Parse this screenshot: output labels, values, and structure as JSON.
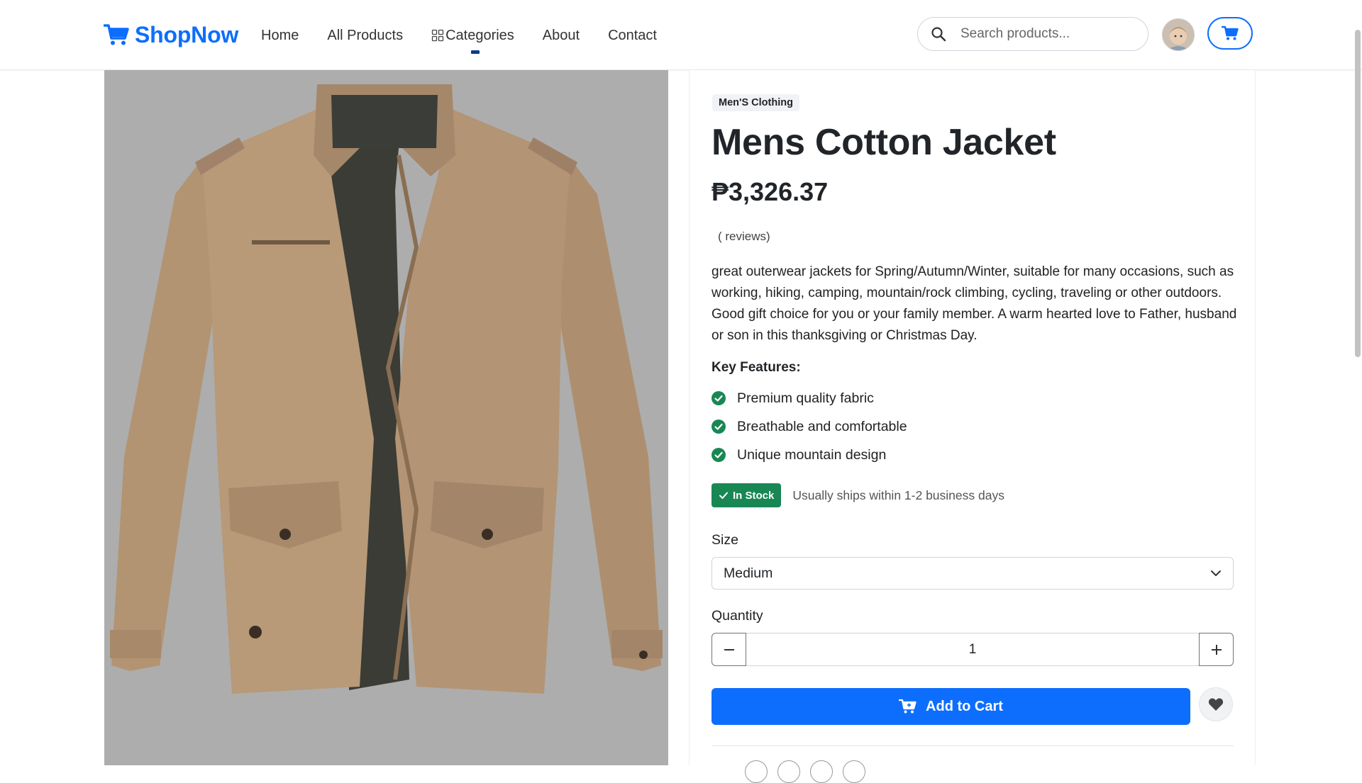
{
  "brand": {
    "name": "ShopNow",
    "icon": "cart-icon",
    "color": "#0d6efd"
  },
  "nav": {
    "links": [
      {
        "label": "Home"
      },
      {
        "label": "All Products"
      },
      {
        "label": "Categories",
        "icon": "grid-icon"
      },
      {
        "label": "About"
      },
      {
        "label": "Contact"
      }
    ]
  },
  "search": {
    "placeholder": "Search products...",
    "value": ""
  },
  "product": {
    "category": "Men'S Clothing",
    "title": "Mens Cotton Jacket",
    "price": "₱3,326.37",
    "reviews": "( reviews)",
    "description": "great outerwear jackets for Spring/Autumn/Winter, suitable for many occasions, such as working, hiking, camping, mountain/rock climbing, cycling, traveling or other outdoors. Good gift choice for you or your family member. A warm hearted love to Father, husband or son in this thanksgiving or Christmas Day.",
    "features_title": "Key Features:",
    "features": [
      "Premium quality fabric",
      "Breathable and comfortable",
      "Unique mountain design"
    ],
    "stock_badge": "In Stock",
    "shipping_note": "Usually ships within 1-2 business days",
    "size_label": "Size",
    "size_value": "Medium",
    "quantity_label": "Quantity",
    "quantity_value": "1",
    "add_to_cart_label": "Add to Cart"
  },
  "colors": {
    "primary": "#0d6efd",
    "success": "#198754",
    "image_background": "#adadad"
  }
}
